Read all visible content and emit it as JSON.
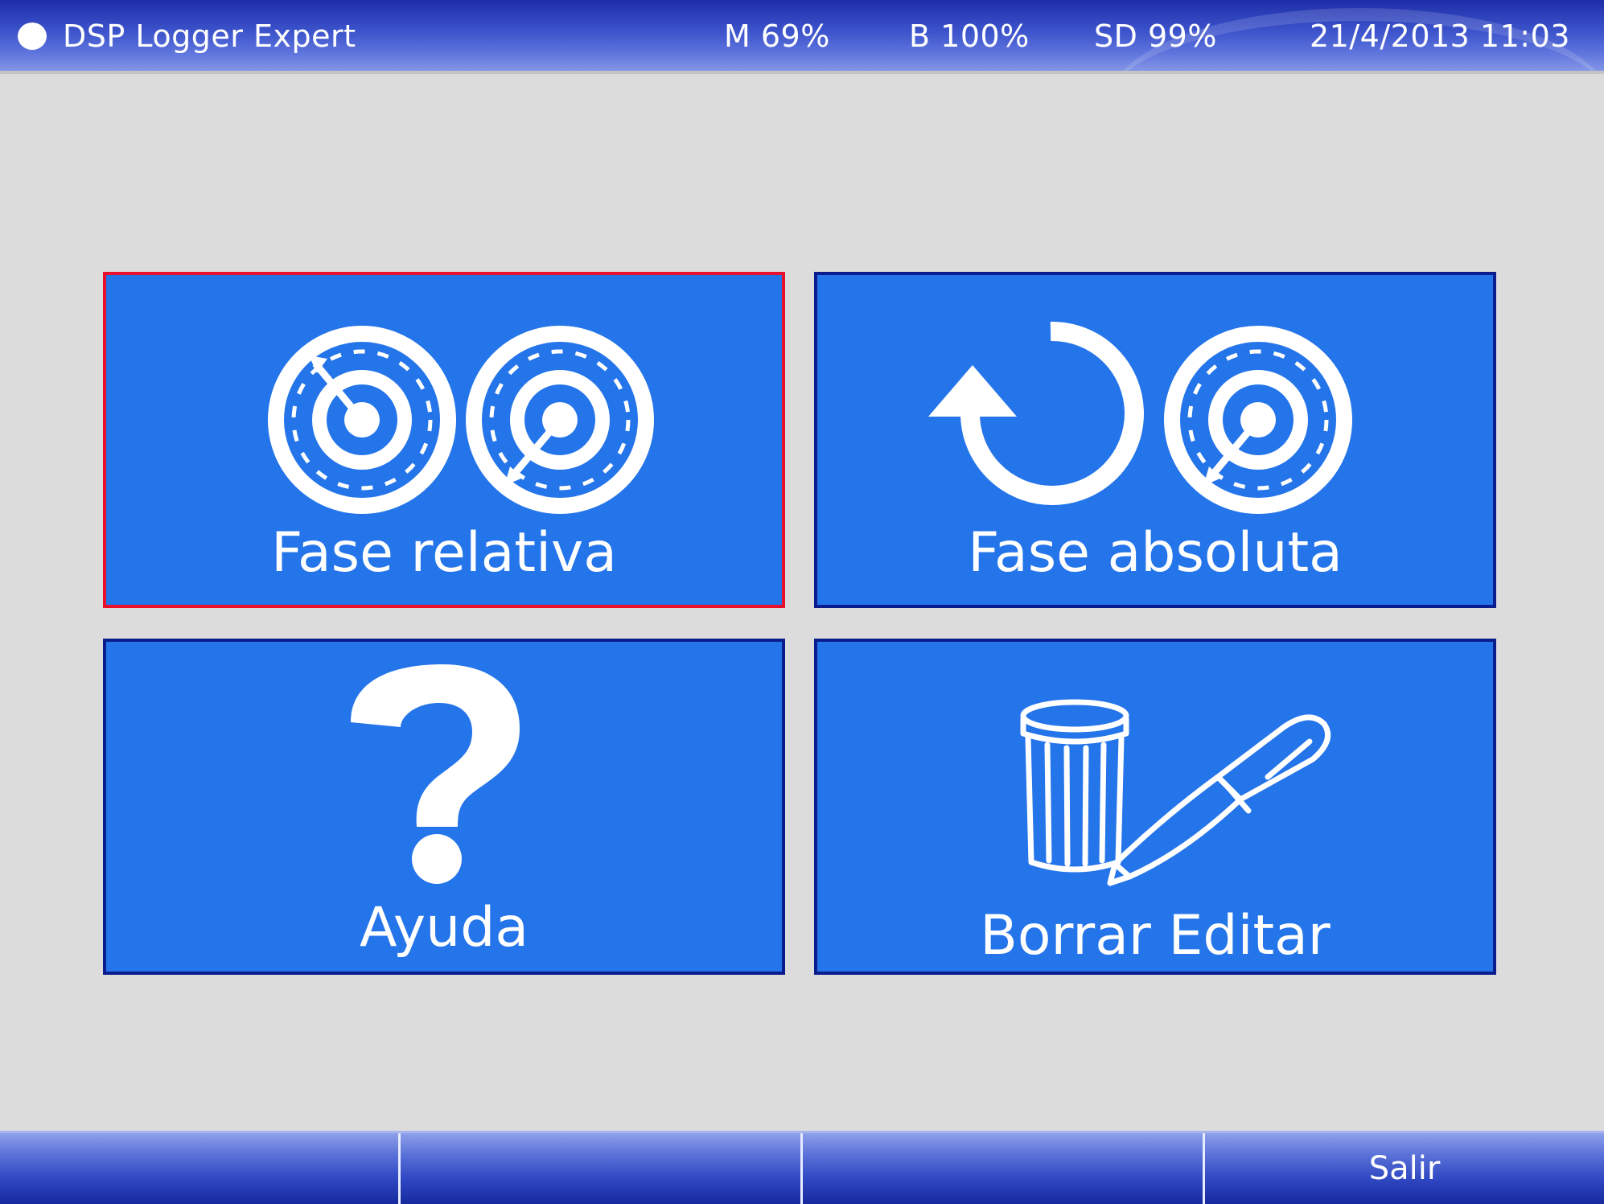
{
  "header": {
    "title": "DSP Logger Expert",
    "memory": "M 69%",
    "battery": "B 100%",
    "sd": "SD 99%",
    "datetime": "21/4/2013 11:03"
  },
  "menu": {
    "tiles": [
      {
        "label": "Fase relativa",
        "icon": "dual-dial-icon",
        "selected": true
      },
      {
        "label": "Fase absoluta",
        "icon": "rotate-dial-icon",
        "selected": false
      },
      {
        "label": "Ayuda",
        "icon": "question-mark-icon",
        "selected": false
      },
      {
        "label": "Borrar Editar",
        "icon": "trash-pen-icon",
        "selected": false
      }
    ]
  },
  "softkeys": [
    "",
    "",
    "",
    "Salir"
  ],
  "colors": {
    "tile_fill": "#2474ea",
    "tile_border": "#0b1d8c",
    "selection_border": "#e8102a",
    "background": "#dcdcdc"
  }
}
